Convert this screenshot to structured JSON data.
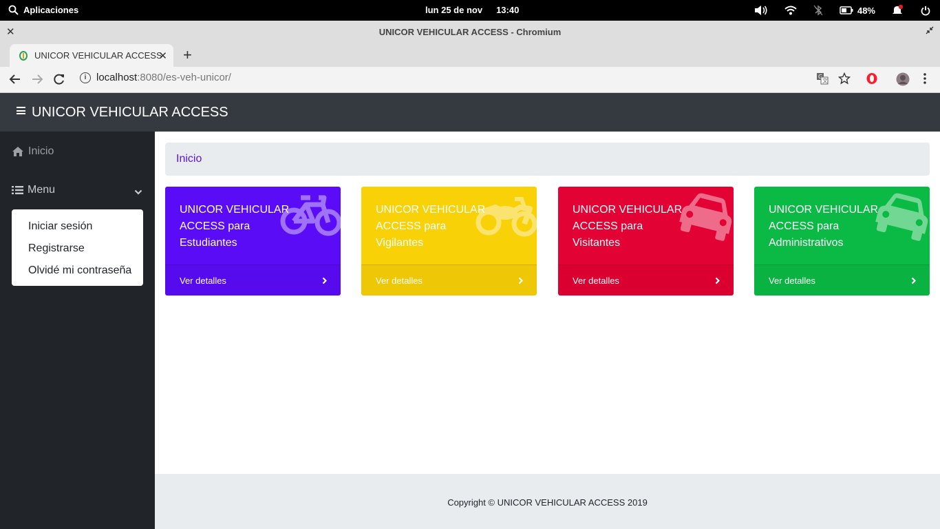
{
  "system_bar": {
    "activities_label": "Aplicaciones",
    "date": "lun 25 de nov",
    "time": "13:40",
    "battery_percent": "48%"
  },
  "window": {
    "title": "UNICOR VEHICULAR ACCESS - Chromium"
  },
  "tab": {
    "title": "UNICOR VEHICULAR ACCESS"
  },
  "omnibox": {
    "host": "localhost",
    "path": ":8080/es-veh-unicor/"
  },
  "navbar": {
    "brand": "UNICOR VEHICULAR ACCESS"
  },
  "sidebar": {
    "inicio_label": "Inicio",
    "menu_label": "Menu",
    "dropdown": [
      {
        "label": "Iniciar sesión"
      },
      {
        "label": "Registrarse"
      },
      {
        "label": "Olvidé mi contraseña"
      }
    ]
  },
  "breadcrumb": {
    "current": "Inicio"
  },
  "cards": [
    {
      "title": "UNICOR VEHICULAR ACCESS para Estudiantes",
      "link": "Ver detalles",
      "color": "#5a0cf6",
      "icon": "bicycle-icon"
    },
    {
      "title": "UNICOR VEHICULAR ACCESS para Vigilantes",
      "link": "Ver detalles",
      "color": "#f8d107",
      "icon": "motorcycle-icon"
    },
    {
      "title": "UNICOR VEHICULAR ACCESS para Visitantes",
      "link": "Ver detalles",
      "color": "#e30234",
      "icon": "car-icon"
    },
    {
      "title": "UNICOR VEHICULAR ACCESS para Administrativos",
      "link": "Ver detalles",
      "color": "#0bba44",
      "icon": "car-icon"
    }
  ],
  "footer": {
    "copyright": "Copyright © UNICOR VEHICULAR ACCESS 2019"
  }
}
